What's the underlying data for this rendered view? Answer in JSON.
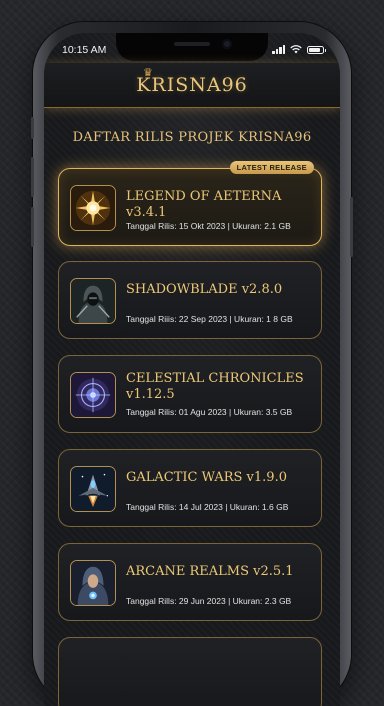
{
  "status_bar": {
    "time": "10:15 AM"
  },
  "header": {
    "brand": "KRISNA96"
  },
  "page": {
    "title": "DAFTAR RILIS PROJEK KRISNA96"
  },
  "featured_badge": "LATEST RELEASE",
  "releases": [
    {
      "title": "LEGEND OF AETERNA v3.4.1",
      "meta": "Tanggal Rilis: 15 Okt 2023 | Ukuran: 2.1 GB",
      "icon": "golden-sun-emblem-icon"
    },
    {
      "title": "SHADOWBLADE v2.8.0",
      "meta": "Tanggal Riiis: 22 Sep 2023 | Ukuran: 1 8 GB",
      "icon": "hooded-assassin-icon"
    },
    {
      "title": "CELESTIAL CHRONICLES v1.12.5",
      "meta": "Tanggal Rilis: 01 Agu 2023 | Ukuran: 3.5 GB",
      "icon": "celestial-orb-icon"
    },
    {
      "title": "GALACTIC WARS v1.9.0",
      "meta": "Tanggal Rilis: 14 Jul 2023 | Ukuran: 1.6 GB",
      "icon": "spaceship-icon"
    },
    {
      "title": "ARCANE REALMS v2.5.1",
      "meta": "Tanggal Rills: 29 Jun 2023 | Ukuran: 2.3 GB",
      "icon": "hooded-mage-icon"
    }
  ],
  "colors": {
    "accent_gold": "#e6c27a",
    "background": "#18191c"
  }
}
